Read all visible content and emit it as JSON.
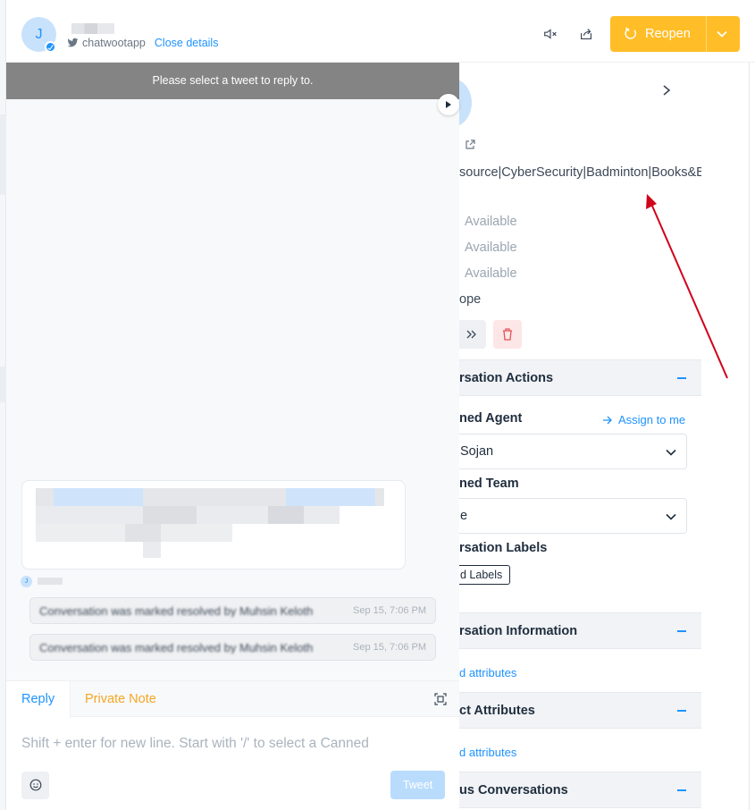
{
  "colors": {
    "brand": "#1f93ff",
    "reopen": "#ffbd27",
    "notice_bg": "#848484",
    "annotation_arrow": "#d0021b"
  },
  "header": {
    "avatar_initial": "J",
    "channel_icon": "twitter-icon",
    "handle": "chatwootapp",
    "close_details": "Close details",
    "mute_icon": "mute-icon",
    "transcript_icon": "share-icon",
    "reopen_label": "Reopen"
  },
  "modal": {
    "notice": "Please select a tweet to reply to.",
    "mini_avatar_initial": "J",
    "activities": [
      {
        "text": "Conversation was marked resolved by Muhsin Keloth",
        "time": "Sep 15, 7:06 PM"
      },
      {
        "text": "Conversation was marked resolved by Muhsin Keloth",
        "time": "Sep 15, 7:06 PM"
      }
    ],
    "reply_tab": "Reply",
    "private_note_tab": "Private Note",
    "placeholder": "Shift + enter for new line. Start with '/' to select a Canned",
    "tweet_button": "Tweet"
  },
  "contact": {
    "bio": "source|CyberSecurity|Badminton|Books&Banter|W",
    "availability": [
      "Available",
      "Available",
      "Available"
    ],
    "nope_text": "ope",
    "sections": {
      "actions": "rsation Actions",
      "agent_label": "ned Agent",
      "assign_to_me": "Assign to me",
      "agent_value": "Sojan",
      "team_label": "ned Team",
      "team_value": "e",
      "labels_label": "rsation Labels",
      "add_labels": "d Labels",
      "info": "rsation Information",
      "info_link": "d attributes",
      "contact_attrs": "ct Attributes",
      "contact_attrs_link": "d attributes",
      "previous": "us Conversations"
    }
  }
}
